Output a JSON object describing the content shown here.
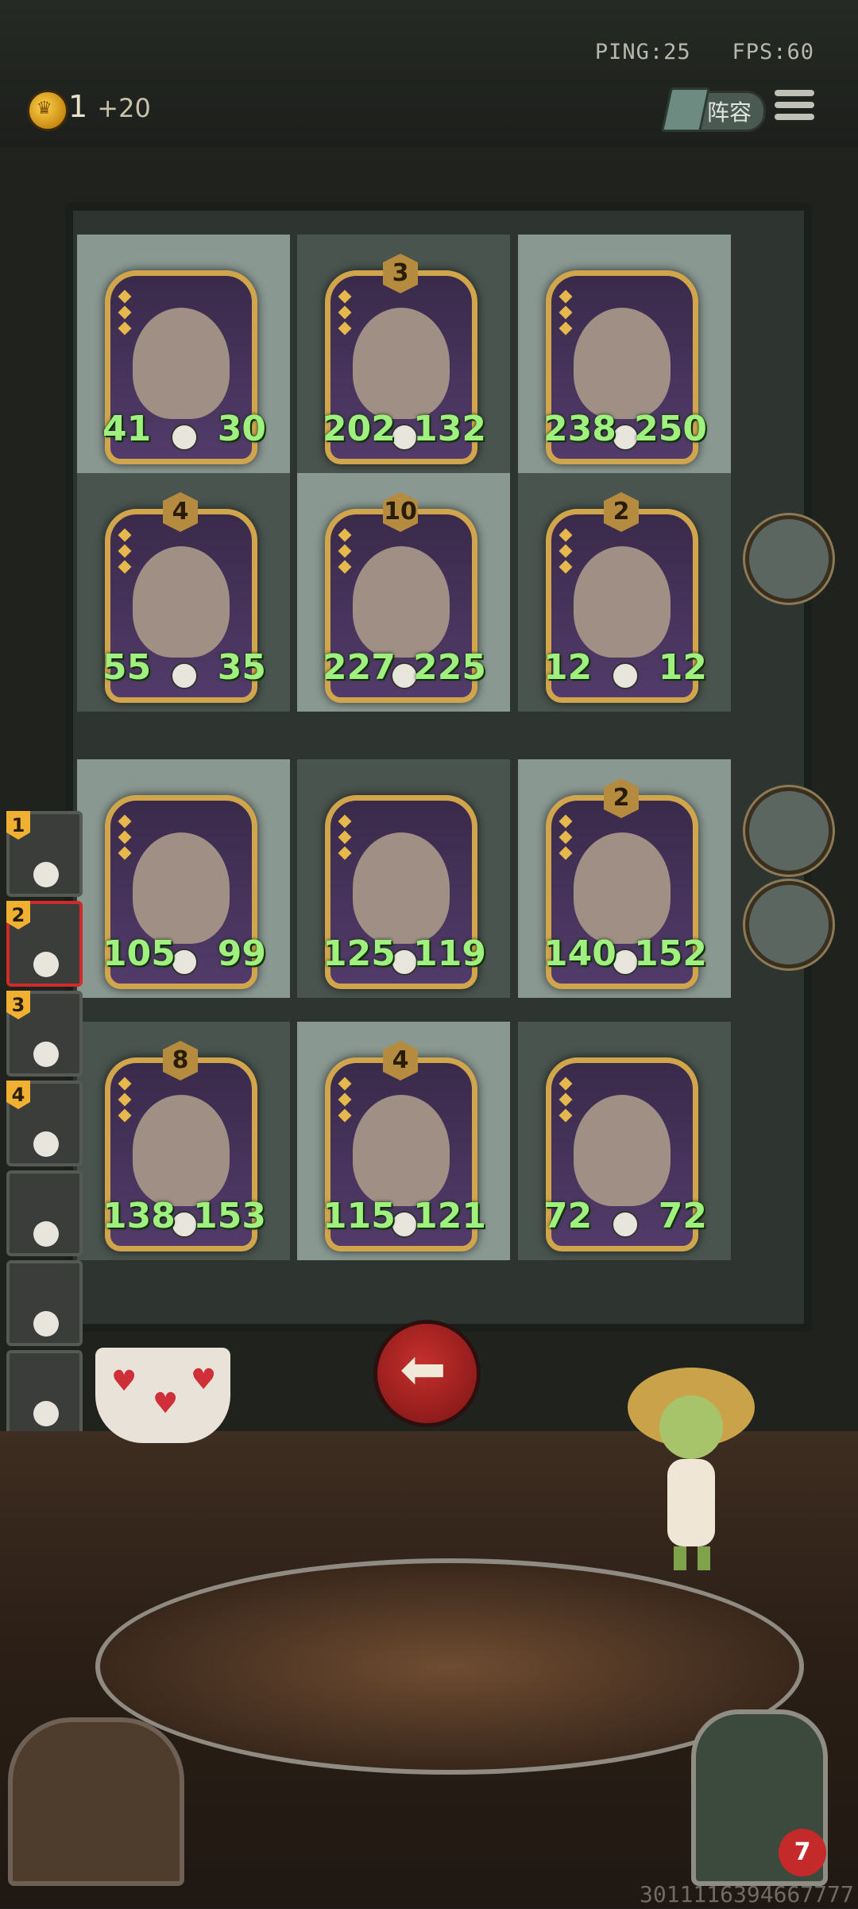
{
  "status": {
    "ping": "PING:25",
    "fps": "FPS:60"
  },
  "gold": {
    "amount": "1",
    "gain": "+20"
  },
  "header": {
    "lineup_label": "阵容"
  },
  "board": {
    "rows": [
      [
        {
          "atk": "41",
          "hp": "30",
          "level": ""
        },
        {
          "atk": "202",
          "hp": "132",
          "level": "3"
        },
        {
          "atk": "238",
          "hp": "250",
          "level": ""
        }
      ],
      [
        {
          "atk": "55",
          "hp": "35",
          "level": "4"
        },
        {
          "atk": "227",
          "hp": "225",
          "level": "10"
        },
        {
          "atk": "12",
          "hp": "12",
          "level": "2"
        }
      ],
      [
        {
          "atk": "105",
          "hp": "99",
          "level": ""
        },
        {
          "atk": "125",
          "hp": "119",
          "level": ""
        },
        {
          "atk": "140",
          "hp": "152",
          "level": "2"
        }
      ],
      [
        {
          "atk": "138",
          "hp": "153",
          "level": "8"
        },
        {
          "atk": "115",
          "hp": "121",
          "level": "4"
        },
        {
          "atk": "72",
          "hp": "72",
          "level": ""
        }
      ]
    ]
  },
  "roster": [
    "1",
    "2",
    "3",
    "4",
    "",
    "",
    "",
    ""
  ],
  "back_label": "返回",
  "player_health": "7",
  "footer_id": "3011116394667777"
}
